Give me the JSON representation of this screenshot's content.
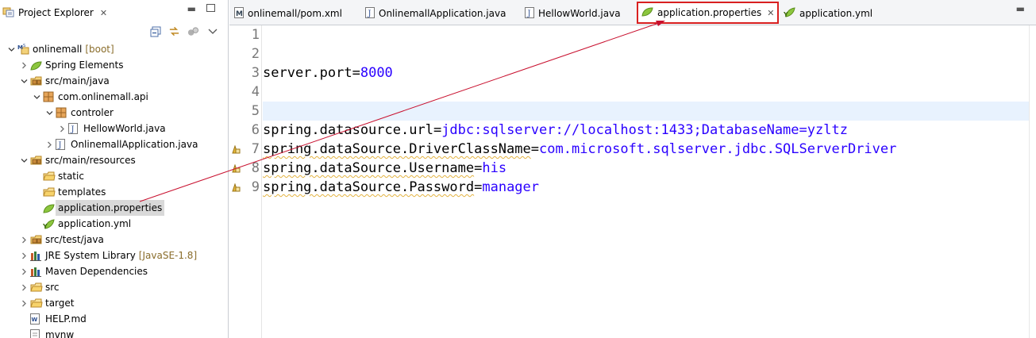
{
  "explorer": {
    "title": "Project Explorer",
    "tree": [
      {
        "label": "onlinemall",
        "deco": "[boot]",
        "icon": "maven-project-icon",
        "arrow": "down",
        "level": 0
      },
      {
        "label": "Spring Elements",
        "icon": "spring-leaf-icon",
        "arrow": "right",
        "level": 1
      },
      {
        "label": "src/main/java",
        "icon": "source-folder-icon",
        "arrow": "down",
        "level": 1
      },
      {
        "label": "com.onlinemall.api",
        "icon": "package-icon",
        "arrow": "down",
        "level": 2
      },
      {
        "label": "controler",
        "icon": "package-icon",
        "arrow": "down",
        "level": 3
      },
      {
        "label": "HellowWorld.java",
        "icon": "java-file-icon",
        "arrow": "right",
        "level": 4
      },
      {
        "label": "OnlinemallApplication.java",
        "icon": "java-file-icon",
        "arrow": "right",
        "level": 3
      },
      {
        "label": "src/main/resources",
        "icon": "source-folder-icon",
        "arrow": "down",
        "level": 1
      },
      {
        "label": "static",
        "icon": "folder-icon",
        "arrow": "",
        "level": 2
      },
      {
        "label": "templates",
        "icon": "folder-icon",
        "arrow": "",
        "level": 2
      },
      {
        "label": "application.properties",
        "icon": "spring-leaf-icon",
        "arrow": "",
        "level": 2,
        "selected": true
      },
      {
        "label": "application.yml",
        "icon": "yaml-file-icon",
        "arrow": "",
        "level": 2
      },
      {
        "label": "src/test/java",
        "icon": "source-folder-icon",
        "arrow": "right",
        "level": 1
      },
      {
        "label": "JRE System Library",
        "deco": "[JavaSE-1.8]",
        "icon": "library-icon",
        "arrow": "right",
        "level": 1
      },
      {
        "label": "Maven Dependencies",
        "icon": "library-icon",
        "arrow": "right",
        "level": 1
      },
      {
        "label": "src",
        "icon": "folder-icon",
        "arrow": "right",
        "level": 1
      },
      {
        "label": "target",
        "icon": "folder-icon",
        "arrow": "right",
        "level": 1
      },
      {
        "label": "HELP.md",
        "icon": "markdown-file-icon",
        "arrow": "",
        "level": 1
      },
      {
        "label": "mvnw",
        "icon": "text-file-icon",
        "arrow": "",
        "level": 1
      }
    ]
  },
  "tabs": [
    {
      "label": "onlinemall/pom.xml",
      "icon": "maven-pom-icon"
    },
    {
      "label": "OnlinemallApplication.java",
      "icon": "java-file-icon"
    },
    {
      "label": "HellowWorld.java",
      "icon": "java-file-icon"
    },
    {
      "label": "application.properties",
      "icon": "spring-leaf-icon",
      "active": true
    },
    {
      "label": "application.yml",
      "icon": "yaml-file-icon"
    }
  ],
  "editor": {
    "line_numbers": [
      "1",
      "2",
      "3",
      "4",
      "5",
      "6",
      "7",
      "8",
      "9"
    ],
    "lines": [
      {
        "key": "",
        "value": ""
      },
      {
        "key": "",
        "value": ""
      },
      {
        "key": "server.port",
        "value": "8000"
      },
      {
        "key": "",
        "value": ""
      },
      {
        "key": "",
        "value": "",
        "current": true
      },
      {
        "key": "spring.datasource.url",
        "value": "jdbc:sqlserver://localhost:1433;DatabaseName=yzltz"
      },
      {
        "key": "spring.dataSource.DriverClassName",
        "value": "com.microsoft.sqlserver.jdbc.SQLServerDriver",
        "warning": true
      },
      {
        "key": "spring.dataSource.Username",
        "value": "his",
        "warning": true
      },
      {
        "key": "spring.dataSource.Password",
        "value": "manager",
        "warning": true
      }
    ]
  },
  "colors": {
    "accent_red": "#d92020",
    "value_blue": "#2a00ff",
    "warning_yellow": "#e3b341"
  }
}
